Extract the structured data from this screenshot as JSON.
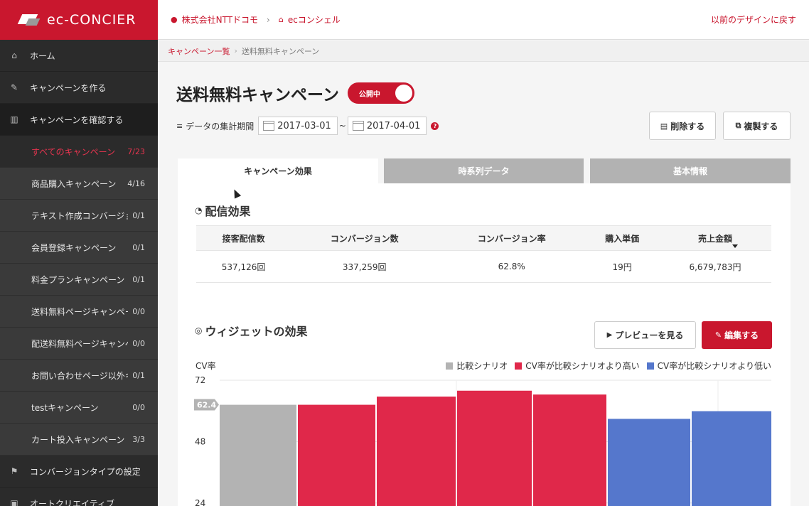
{
  "brand": {
    "name": "ec-CONCIER",
    "accent": "#c9172e"
  },
  "topbar": {
    "company": "株式会社NTTドコモ",
    "service": "ecコンシェル",
    "back_link": "以前のデザインに戻す"
  },
  "sidebar": {
    "items": [
      {
        "label": "ホーム",
        "icon": "home-icon"
      },
      {
        "label": "キャンペーンを作る",
        "icon": "edit-icon"
      },
      {
        "label": "キャンペーンを確認する",
        "icon": "bar-chart-icon"
      }
    ],
    "sub_items": [
      {
        "label": "すべてのキャンペーン",
        "count": "7/23"
      },
      {
        "label": "商品購入キャンペーン",
        "count": "4/16"
      },
      {
        "label": "テキスト作成コンバージョン",
        "count": "0/1"
      },
      {
        "label": "会員登録キャンペーン",
        "count": "0/1"
      },
      {
        "label": "料金プランキャンペーン",
        "count": "0/1"
      },
      {
        "label": "送料無料ページキャンペーン",
        "count": "0/0"
      },
      {
        "label": "配送料無料ページキャンペーン",
        "count": "0/0"
      },
      {
        "label": "お問い合わせページ以外キャンペーン",
        "count": "0/1"
      },
      {
        "label": "testキャンペーン",
        "count": "0/0"
      },
      {
        "label": "カート投入キャンペーン",
        "count": "3/3"
      }
    ],
    "bottom_items": [
      {
        "label": "コンバージョンタイプの設定",
        "icon": "flag-icon"
      },
      {
        "label": "オートクリエイティブ",
        "icon": "image-icon"
      }
    ]
  },
  "breadcrumb": {
    "parent": "キャンペーン一覧",
    "current": "送料無料キャンペーン"
  },
  "campaign": {
    "title": "送料無料キャンペーン",
    "status_label": "公開中",
    "period_label": "データの集計期間",
    "start_date": "2017-03-01",
    "end_date": "2017-04-01",
    "range_sep": "~",
    "delete_label": "削除する",
    "duplicate_label": "複製する"
  },
  "tabs": [
    {
      "label": "キャンペーン効果"
    },
    {
      "label": "時系列データ"
    },
    {
      "label": "基本情報"
    }
  ],
  "delivery": {
    "title": "配信効果",
    "headers": [
      "接客配信数",
      "コンバージョン数",
      "コンバージョン率",
      "購入単価",
      "売上金額"
    ],
    "values": [
      "537,126回",
      "337,259回",
      "62.8%",
      "19円",
      "6,679,783円"
    ]
  },
  "widget": {
    "title": "ウィジェットの効果",
    "preview_label": "プレビューを見る",
    "edit_label": "編集する"
  },
  "chart_data": {
    "type": "bar",
    "ylabel": "CV率",
    "yticks": [
      72,
      48,
      24
    ],
    "ylim": [
      24,
      72
    ],
    "reference_label": "62.4",
    "legend": [
      {
        "name": "比較シナリオ",
        "color": "#b3b3b3"
      },
      {
        "name": "CV率が比較シナリオより高い",
        "color": "#e0284a"
      },
      {
        "name": "CV率が比較シナリオより低い",
        "color": "#5577cc"
      }
    ],
    "bars": [
      {
        "value": 62.4,
        "group": 0
      },
      {
        "value": 62.4,
        "group": 1
      },
      {
        "value": 65.6,
        "group": 1
      },
      {
        "value": 67.9,
        "group": 1
      },
      {
        "value": 66.4,
        "group": 1
      },
      {
        "value": 56.9,
        "group": 2
      },
      {
        "value": 59.9,
        "group": 2
      }
    ]
  }
}
